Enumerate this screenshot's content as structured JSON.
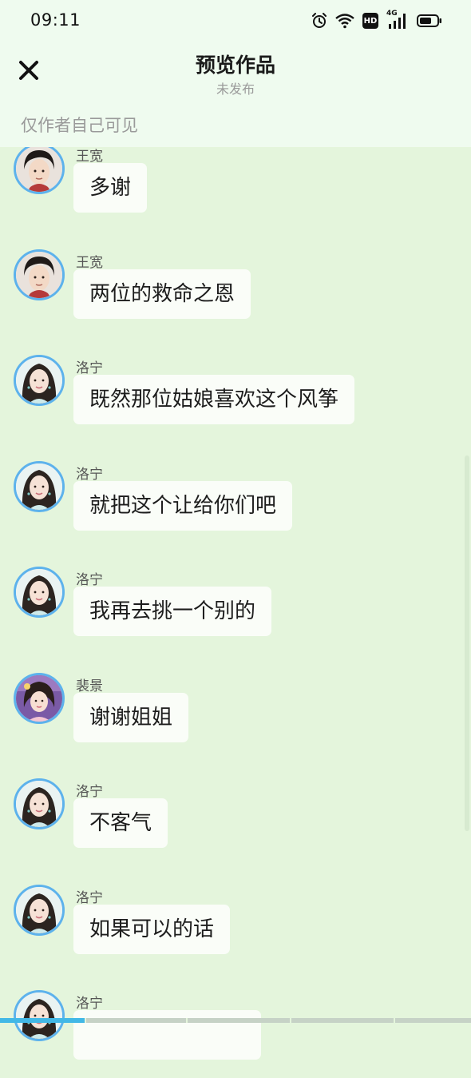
{
  "status_bar": {
    "time": "09:11",
    "hd_label": "HD",
    "network_label": "4G",
    "battery_percent": 70
  },
  "header": {
    "title": "预览作品",
    "subtitle": "未发布",
    "visibility_note": "仅作者自己可见"
  },
  "messages": [
    {
      "sender": "王宽",
      "text": "多谢",
      "avatar": "man"
    },
    {
      "sender": "王宽",
      "text": "两位的救命之恩",
      "avatar": "man"
    },
    {
      "sender": "洛宁",
      "text": "既然那位姑娘喜欢这个风筝",
      "avatar": "woman"
    },
    {
      "sender": "洛宁",
      "text": "就把这个让给你们吧",
      "avatar": "woman"
    },
    {
      "sender": "洛宁",
      "text": "我再去挑一个别的",
      "avatar": "woman"
    },
    {
      "sender": "裴景",
      "text": "谢谢姐姐",
      "avatar": "girl"
    },
    {
      "sender": "洛宁",
      "text": "不客气",
      "avatar": "woman"
    },
    {
      "sender": "洛宁",
      "text": "如果可以的话",
      "avatar": "woman"
    },
    {
      "sender": "洛宁",
      "text": "",
      "avatar": "woman"
    }
  ],
  "playback": {
    "progress_fraction": 0.18
  },
  "colors": {
    "header_bg": "#effbef",
    "chat_bg": "#e4f5dc",
    "bubble_bg": "#fafdf8",
    "avatar_ring": "#5db2ec",
    "progress_accent": "#42b8e6"
  }
}
